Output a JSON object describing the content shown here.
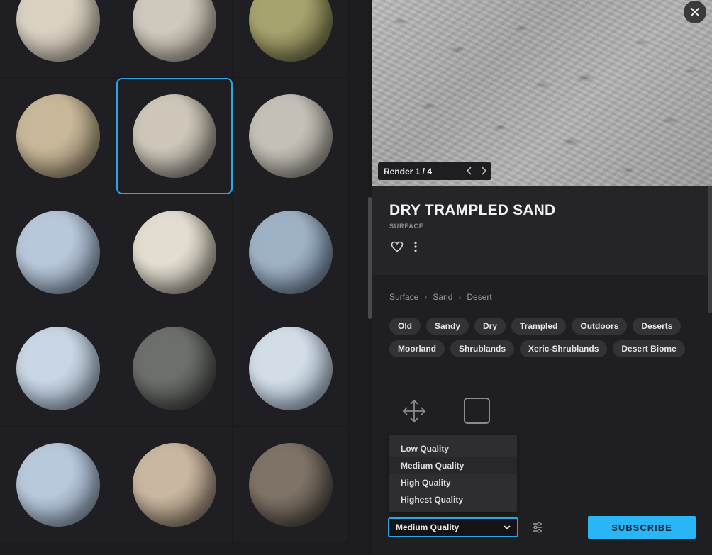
{
  "grid": {
    "materials": [
      {
        "colors": [
          "#d9d1c1",
          "#8c8477"
        ],
        "selected": false
      },
      {
        "colors": [
          "#cfc8bd",
          "#7d7669"
        ],
        "selected": false
      },
      {
        "colors": [
          "#a6a36e",
          "#4f4b2d"
        ],
        "selected": false
      },
      {
        "colors": [
          "#c8b899",
          "#6a5e4a"
        ],
        "selected": false
      },
      {
        "colors": [
          "#cdc6b9",
          "#5d5a53"
        ],
        "selected": true
      },
      {
        "colors": [
          "#c4c0b6",
          "#6a675f"
        ],
        "selected": false
      },
      {
        "colors": [
          "#b8c8da",
          "#5b6a7d"
        ],
        "selected": false
      },
      {
        "colors": [
          "#e3ddd1",
          "#6c665c"
        ],
        "selected": false
      },
      {
        "colors": [
          "#9fb2c5",
          "#47556a"
        ],
        "selected": false
      },
      {
        "colors": [
          "#c9d6e4",
          "#6b7a8c"
        ],
        "selected": false
      },
      {
        "colors": [
          "#6d6f6c",
          "#262826"
        ],
        "selected": false
      },
      {
        "colors": [
          "#d2dde8",
          "#6e7e90"
        ],
        "selected": false
      },
      {
        "colors": [
          "#b9c9dc",
          "#5e6c80"
        ],
        "selected": false
      },
      {
        "colors": [
          "#c9b7a1",
          "#5a4d3f"
        ],
        "selected": false
      },
      {
        "colors": [
          "#7f7368",
          "#2e2925"
        ],
        "selected": false
      }
    ]
  },
  "render": {
    "label": "Render 1 / 4"
  },
  "detail": {
    "title": "DRY TRAMPLED SAND",
    "category": "SURFACE",
    "breadcrumb": [
      "Surface",
      "Sand",
      "Desert"
    ],
    "tags": [
      "Old",
      "Sandy",
      "Dry",
      "Trampled",
      "Outdoors",
      "Deserts",
      "Moorland",
      "Shrublands",
      "Xeric-Shrublands",
      "Desert Biome"
    ]
  },
  "quality": {
    "options": [
      "Low Quality",
      "Medium Quality",
      "High Quality",
      "Highest Quality"
    ],
    "active_index": 1,
    "selected": "Medium Quality"
  },
  "subscribe_label": "SUBSCRIBE",
  "colors": {
    "accent": "#29b6f6",
    "selection_border": "#2aa6e6"
  }
}
